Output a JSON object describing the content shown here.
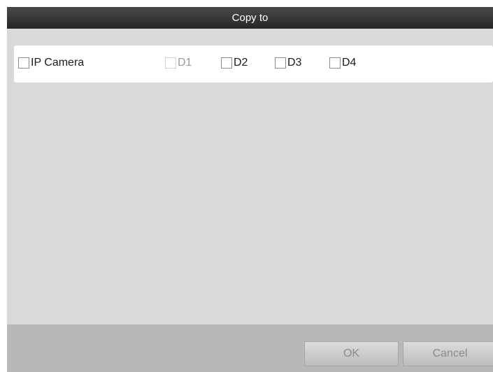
{
  "dialog": {
    "title": "Copy to"
  },
  "channels": {
    "ip_camera_label": "IP Camera",
    "items": [
      {
        "label": "D1",
        "enabled": false,
        "checked": false
      },
      {
        "label": "D2",
        "enabled": true,
        "checked": false
      },
      {
        "label": "D3",
        "enabled": true,
        "checked": false
      },
      {
        "label": "D4",
        "enabled": true,
        "checked": false
      }
    ]
  },
  "footer": {
    "ok_label": "OK",
    "cancel_label": "Cancel"
  }
}
